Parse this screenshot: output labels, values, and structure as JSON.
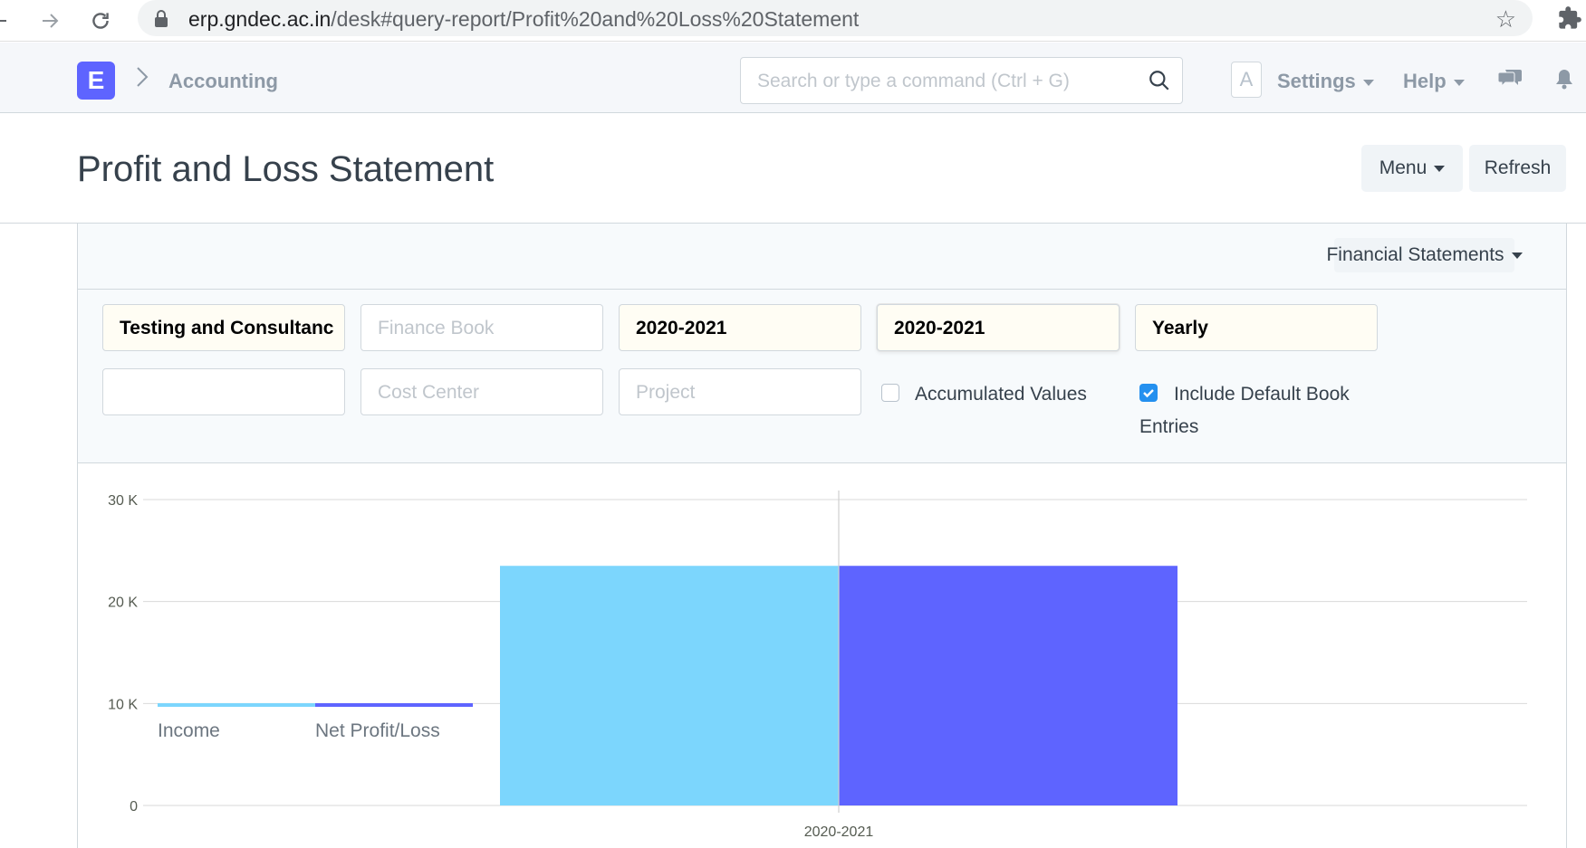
{
  "browser": {
    "url_host": "erp.gndec.ac.in",
    "url_path": "/desk#query-report/Profit%20and%20Loss%20Statement"
  },
  "navbar": {
    "logo_letter": "E",
    "breadcrumb": "Accounting",
    "search_placeholder": "Search or type a command (Ctrl + G)",
    "avatar_letter": "A",
    "settings_label": "Settings",
    "help_label": "Help"
  },
  "page": {
    "title": "Profit and Loss Statement",
    "menu_label": "Menu",
    "refresh_label": "Refresh",
    "financial_statements_label": "Financial Statements"
  },
  "filters": {
    "company": "Testing and Consultanc",
    "finance_book_placeholder": "Finance Book",
    "from_fiscal_year": "2020-2021",
    "to_fiscal_year": "2020-2021",
    "periodicity": "Yearly",
    "field_empty": "",
    "cost_center_placeholder": "Cost Center",
    "project_placeholder": "Project",
    "accumulated_values_label": "Accumulated Values",
    "accumulated_values_checked": false,
    "include_default_book_entries_label_1": "Include Default Book",
    "include_default_book_entries_label_2": "Entries",
    "include_default_book_entries_checked": true
  },
  "chart_data": {
    "type": "bar",
    "categories": [
      "2020-2021"
    ],
    "series": [
      {
        "name": "Income",
        "values": [
          23500
        ],
        "color": "#7cd6fd"
      },
      {
        "name": "Net Profit/Loss",
        "values": [
          23500
        ],
        "color": "#5e64ff"
      }
    ],
    "y_ticks": [
      "0",
      "10 K",
      "20 K",
      "30 K"
    ],
    "ylim": [
      0,
      30000
    ],
    "grid": true,
    "legend_position": "bottom-left"
  }
}
